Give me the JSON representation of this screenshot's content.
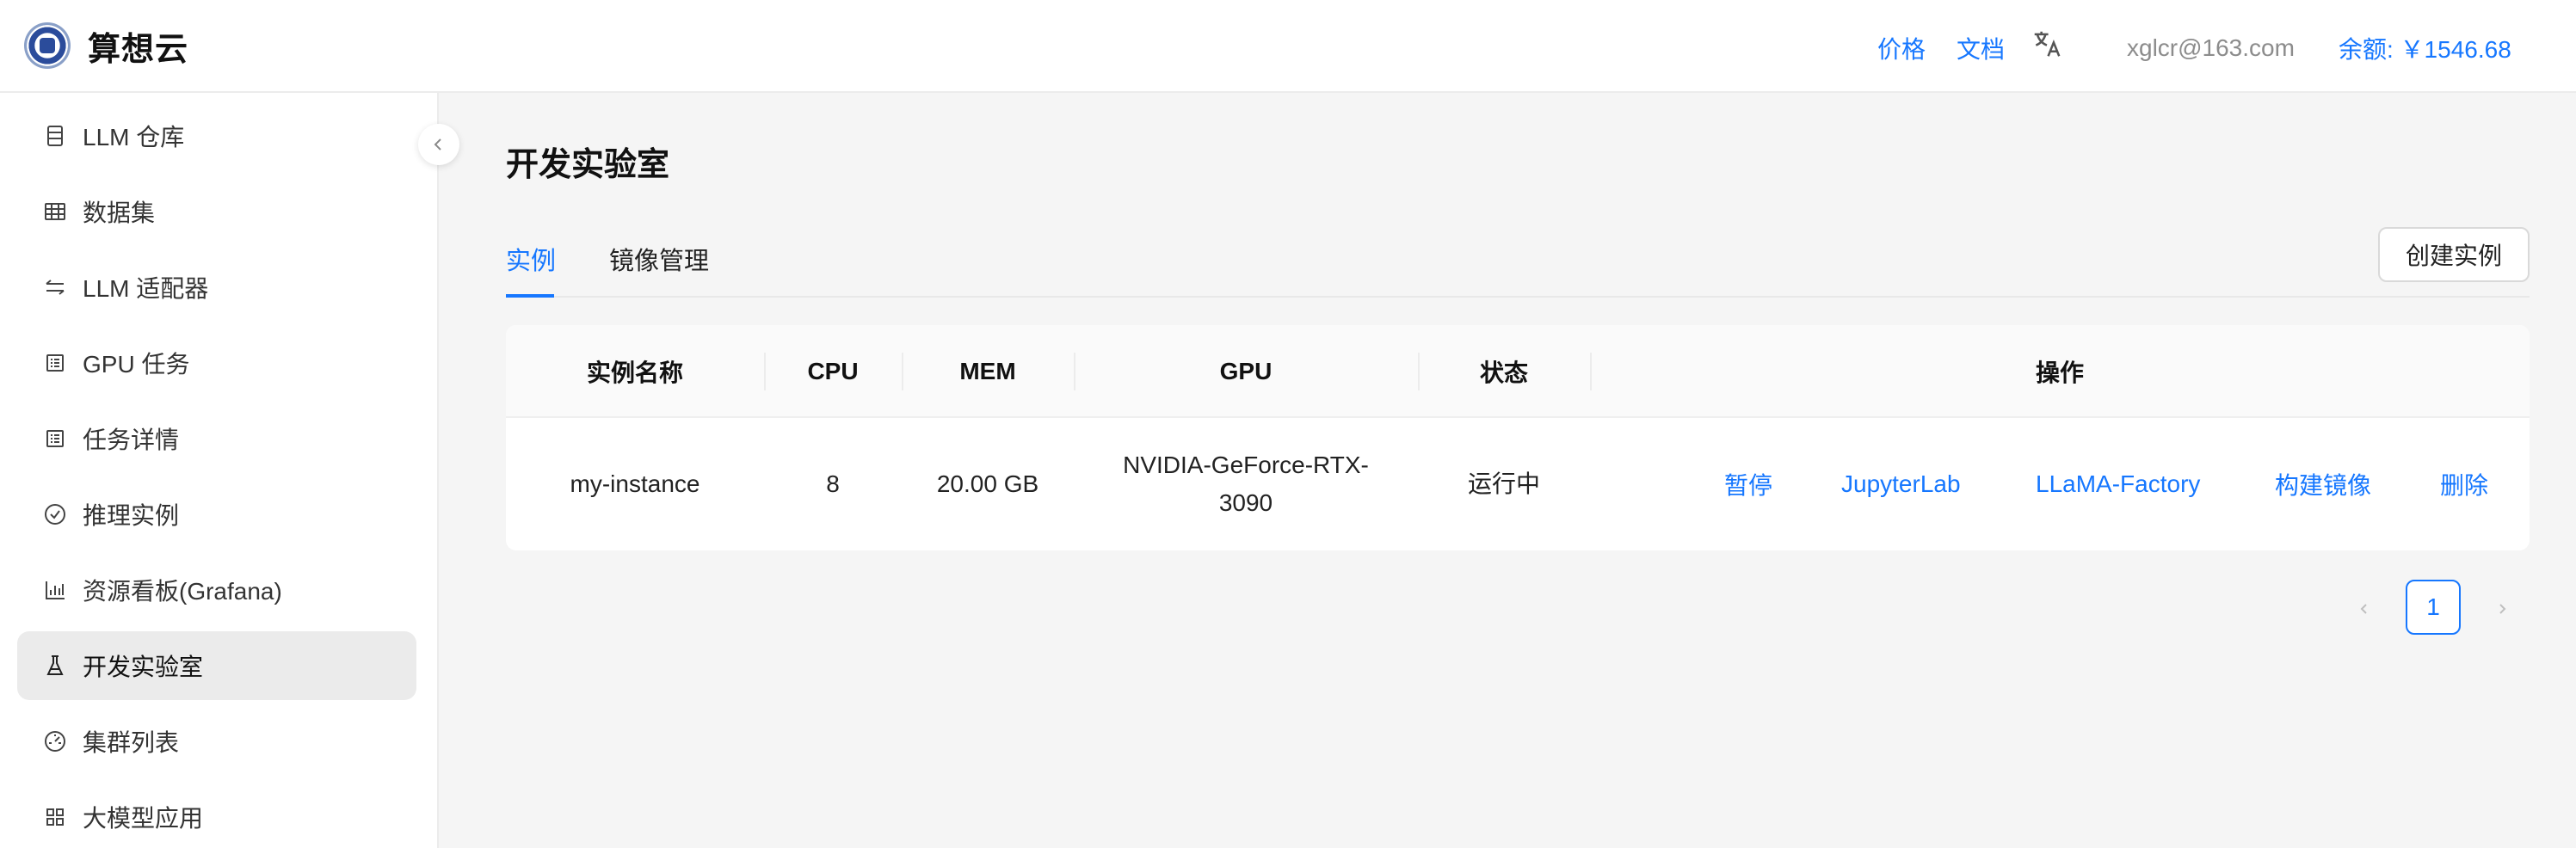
{
  "header": {
    "app_title": "算想云",
    "price_link": "价格",
    "docs_link": "文档",
    "user_email": "xglcr@163.com",
    "balance": "余额: ￥1546.68"
  },
  "sidebar": {
    "items": [
      {
        "label": "LLM 仓库",
        "icon": "database-icon"
      },
      {
        "label": "数据集",
        "icon": "table-icon"
      },
      {
        "label": "LLM 适配器",
        "icon": "swap-icon"
      },
      {
        "label": "GPU 任务",
        "icon": "list-icon"
      },
      {
        "label": "任务详情",
        "icon": "list-icon"
      },
      {
        "label": "推理实例",
        "icon": "check-circle-icon"
      },
      {
        "label": "资源看板(Grafana)",
        "icon": "bar-chart-icon"
      },
      {
        "label": "开发实验室",
        "icon": "flask-icon",
        "active": true
      },
      {
        "label": "集群列表",
        "icon": "dashboard-icon"
      },
      {
        "label": "大模型应用",
        "icon": "apps-icon"
      }
    ]
  },
  "main": {
    "page_title": "开发实验室",
    "tabs": [
      {
        "label": "实例",
        "active": true
      },
      {
        "label": "镜像管理",
        "active": false
      }
    ],
    "create_button": "创建实例",
    "table": {
      "headers": [
        "实例名称",
        "CPU",
        "MEM",
        "GPU",
        "状态",
        "操作"
      ],
      "rows": [
        {
          "name": "my-instance",
          "cpu": "8",
          "mem": "20.00 GB",
          "gpu_line1": "NVIDIA-GeForce-RTX-",
          "gpu_line2": "3090",
          "status": "运行中",
          "actions": [
            "暂停",
            "JupyterLab",
            "LLaMA-Factory",
            "构建镜像",
            "删除"
          ]
        }
      ]
    },
    "pagination": {
      "current_page": "1"
    }
  },
  "colors": {
    "accent": "#1677ff",
    "active_nav_bg": "#ebebeb"
  }
}
